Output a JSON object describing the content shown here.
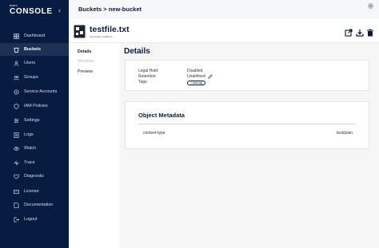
{
  "sidebar": {
    "brand_small": "MINIO",
    "brand": "CONSOLE",
    "items": [
      {
        "label": "Dashboard",
        "icon": "dashboard-icon"
      },
      {
        "label": "Buckets",
        "icon": "bucket-icon",
        "active": true
      },
      {
        "label": "Users",
        "icon": "users-icon"
      },
      {
        "label": "Groups",
        "icon": "groups-icon"
      },
      {
        "label": "Service Accounts",
        "icon": "service-accounts-icon"
      },
      {
        "label": "IAM Policies",
        "icon": "policy-icon"
      },
      {
        "label": "Settings",
        "icon": "settings-icon"
      },
      {
        "label": "Logs",
        "icon": "logs-icon"
      },
      {
        "label": "Watch",
        "icon": "watch-icon"
      },
      {
        "label": "Trace",
        "icon": "trace-icon"
      },
      {
        "label": "Diagnostic",
        "icon": "diagnostic-icon"
      },
      {
        "label": "License",
        "icon": "license-icon"
      },
      {
        "label": "Documentation",
        "icon": "documentation-icon"
      },
      {
        "label": "Logout",
        "icon": "logout-icon"
      }
    ]
  },
  "header": {
    "breadcrumb": "Buckets > new-bucket"
  },
  "object": {
    "name": "testfile.txt",
    "path": "new-bucket / testfile.txt"
  },
  "tabs": [
    {
      "label": "Details",
      "state": "active"
    },
    {
      "label": "Versions",
      "state": "disabled"
    },
    {
      "label": "Preview",
      "state": "normal"
    }
  ],
  "details": {
    "title": "Details",
    "legal_hold_label": "Legal Hold:",
    "legal_hold_value": "Disabled",
    "retention_label": "Retention:",
    "retention_value": "Undefined",
    "tags_label": "Tags:",
    "add_tag_label": "+ Add tag"
  },
  "metadata": {
    "title": "Object Metadata",
    "rows": [
      {
        "key": "content-type",
        "value": "text/plain"
      }
    ]
  },
  "colors": {
    "sidebar_bg": "#081c42",
    "accent": "#081c42"
  }
}
